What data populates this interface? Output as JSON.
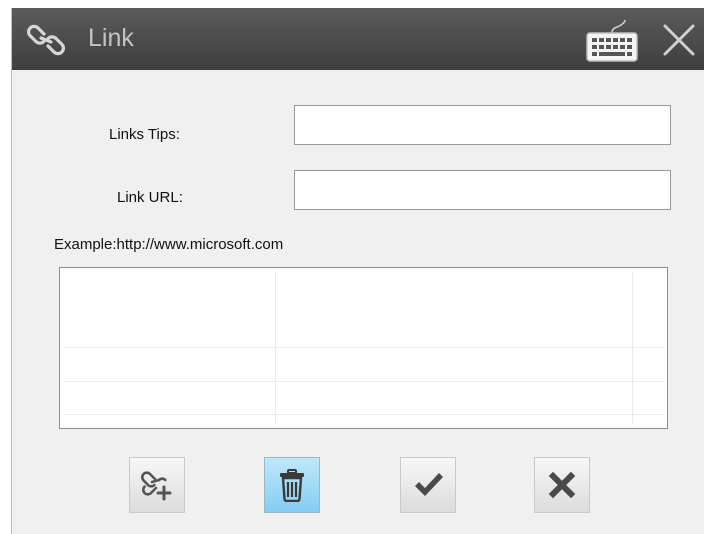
{
  "window": {
    "title": "Link",
    "title_icon": "link-icon",
    "keyboard_icon": "keyboard-icon",
    "close_icon": "close-icon"
  },
  "form": {
    "tips_label": "Links Tips:",
    "tips_value": "",
    "url_label": "Link URL:",
    "url_value": "",
    "example": "Example:http://www.microsoft.com"
  },
  "links_list": {
    "rows": []
  },
  "toolbar": {
    "buttons": [
      {
        "name": "add-link",
        "icon": "add-link-icon"
      },
      {
        "name": "delete",
        "icon": "trash-icon",
        "active": true
      },
      {
        "name": "ok",
        "icon": "checkmark-icon"
      },
      {
        "name": "cancel",
        "icon": "x-icon"
      }
    ]
  },
  "colors": {
    "titlebar": "#4a4a4a",
    "title_text": "#c4c4c4",
    "dialog_bg": "#f0f0f0",
    "active_button": "#9fd9f6"
  }
}
